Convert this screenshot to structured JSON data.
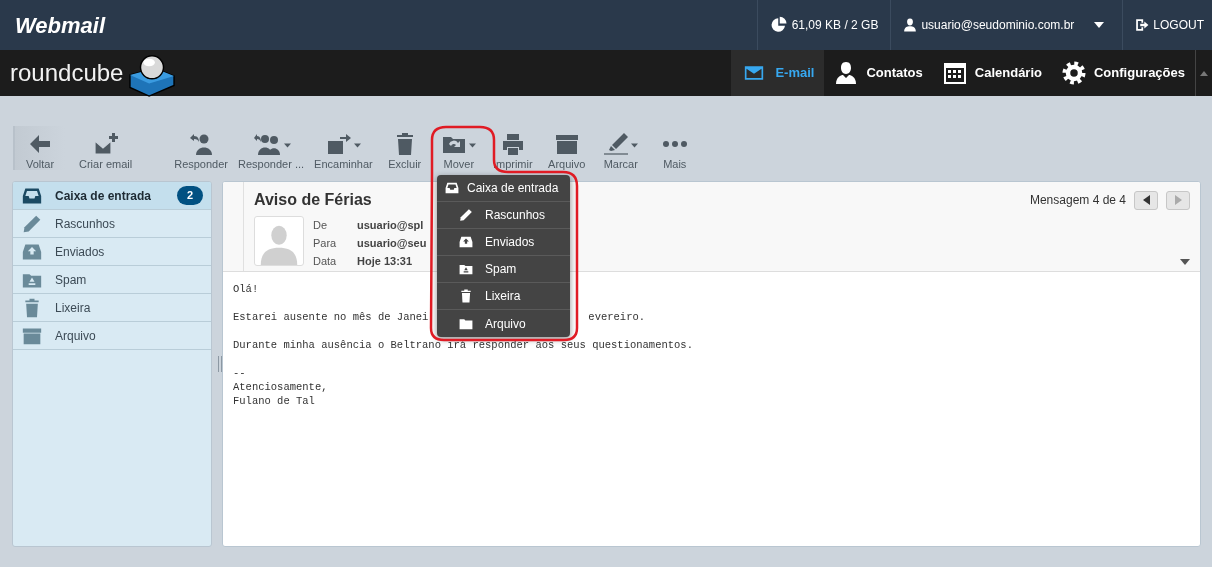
{
  "brand": {
    "title": "Webmail",
    "logo_text": "roundcube"
  },
  "topbar": {
    "quota": "61,09 KB / 2 GB",
    "user": "usuario@seudominio.com.br",
    "logout": "LOGOUT"
  },
  "nav": [
    {
      "label": "E-mail",
      "selected": true
    },
    {
      "label": "Contatos",
      "selected": false
    },
    {
      "label": "Calendário",
      "selected": false
    },
    {
      "label": "Configurações",
      "selected": false
    }
  ],
  "toolbar": [
    [
      {
        "label": "Voltar",
        "dropdown": false
      }
    ],
    [
      {
        "label": "Criar email",
        "dropdown": false
      }
    ],
    [
      {
        "label": "Responder",
        "dropdown": false
      },
      {
        "label": "Responder ...",
        "dropdown": true
      },
      {
        "label": "Encaminhar",
        "dropdown": true
      },
      {
        "label": "Excluir",
        "dropdown": false
      },
      {
        "label": "Mover",
        "dropdown": true
      },
      {
        "label": "Imprimir",
        "dropdown": false
      },
      {
        "label": "Arquivo",
        "dropdown": false
      },
      {
        "label": "Marcar",
        "dropdown": true
      },
      {
        "label": "Mais",
        "dropdown": false
      }
    ]
  ],
  "folders": [
    {
      "label": "Caixa de entrada",
      "selected": true,
      "count": "2"
    },
    {
      "label": "Rascunhos",
      "selected": false
    },
    {
      "label": "Enviados",
      "selected": false
    },
    {
      "label": "Spam",
      "selected": false
    },
    {
      "label": "Lixeira",
      "selected": false
    },
    {
      "label": "Arquivo",
      "selected": false
    }
  ],
  "message": {
    "subject": "Aviso de Férias",
    "counter": "Mensagem 4 de 4",
    "prev": {
      "disabled": false
    },
    "next": {
      "disabled": true
    },
    "headers": [
      {
        "label": "De",
        "value": "usuario@spl"
      },
      {
        "label": "Para",
        "value": "usuario@seu"
      },
      {
        "label": "Data",
        "value": "Hoje 13:31"
      }
    ],
    "body": [
      [
        [
          "Olá!"
        ]
      ],
      [
        [
          "Estarei ausente no mês de Janei",
          "evereiro."
        ]
      ],
      [
        [
          "Durante minha ausência o Beltrano irá responder aos seus questionamentos."
        ]
      ],
      [
        [
          "--"
        ],
        [
          "Atenciosamente,"
        ],
        [
          "Fulano de Tal"
        ]
      ]
    ]
  },
  "move_menu": {
    "items": [
      {
        "label": "Caixa de entrada",
        "children": [
          {
            "label": "Rascunhos"
          },
          {
            "label": "Enviados"
          },
          {
            "label": "Spam"
          },
          {
            "label": "Lixeira"
          },
          {
            "label": "Arquivo"
          }
        ]
      }
    ]
  }
}
